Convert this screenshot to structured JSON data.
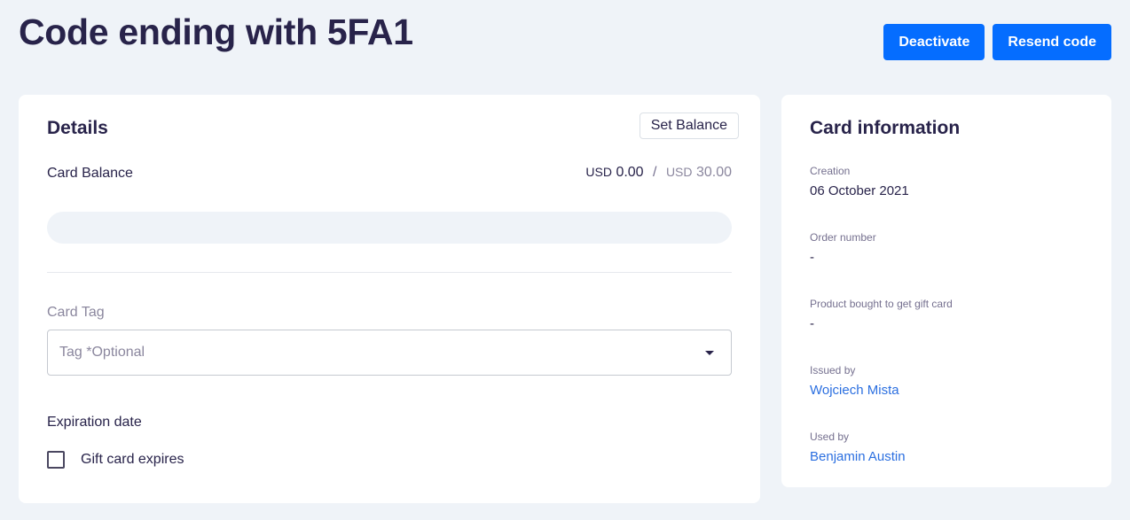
{
  "header": {
    "title": "Code ending with 5FA1",
    "deactivate_label": "Deactivate",
    "resend_label": "Resend code"
  },
  "details": {
    "heading": "Details",
    "set_balance_label": "Set Balance",
    "balance_label": "Card Balance",
    "current_currency": "USD",
    "current_amount": "0.00",
    "separator": "/",
    "initial_currency": "USD",
    "initial_amount": "30.00",
    "balance_used_fraction": 0,
    "tag_label": "Card Tag",
    "tag_placeholder": "Tag *Optional",
    "expiration_label": "Expiration date",
    "expires_checkbox_label": "Gift card expires",
    "expires_checked": false
  },
  "card_info": {
    "heading": "Card information",
    "items": [
      {
        "label": "Creation",
        "value": "06 October 2021"
      },
      {
        "label": "Order number",
        "value": "-"
      },
      {
        "label": "Product bought to get gift card",
        "value": "-"
      },
      {
        "label": "Issued by",
        "value": "Wojciech Mista"
      },
      {
        "label": "Used by",
        "value": "Benjamin Austin"
      }
    ]
  },
  "colors": {
    "primary": "#056dff",
    "link": "#2b6fe0",
    "background": "#eff3f8",
    "text": "#28234a"
  },
  "icons": {
    "tag_dropdown": "caret-down-icon",
    "expires_checkbox": "checkbox-icon"
  }
}
